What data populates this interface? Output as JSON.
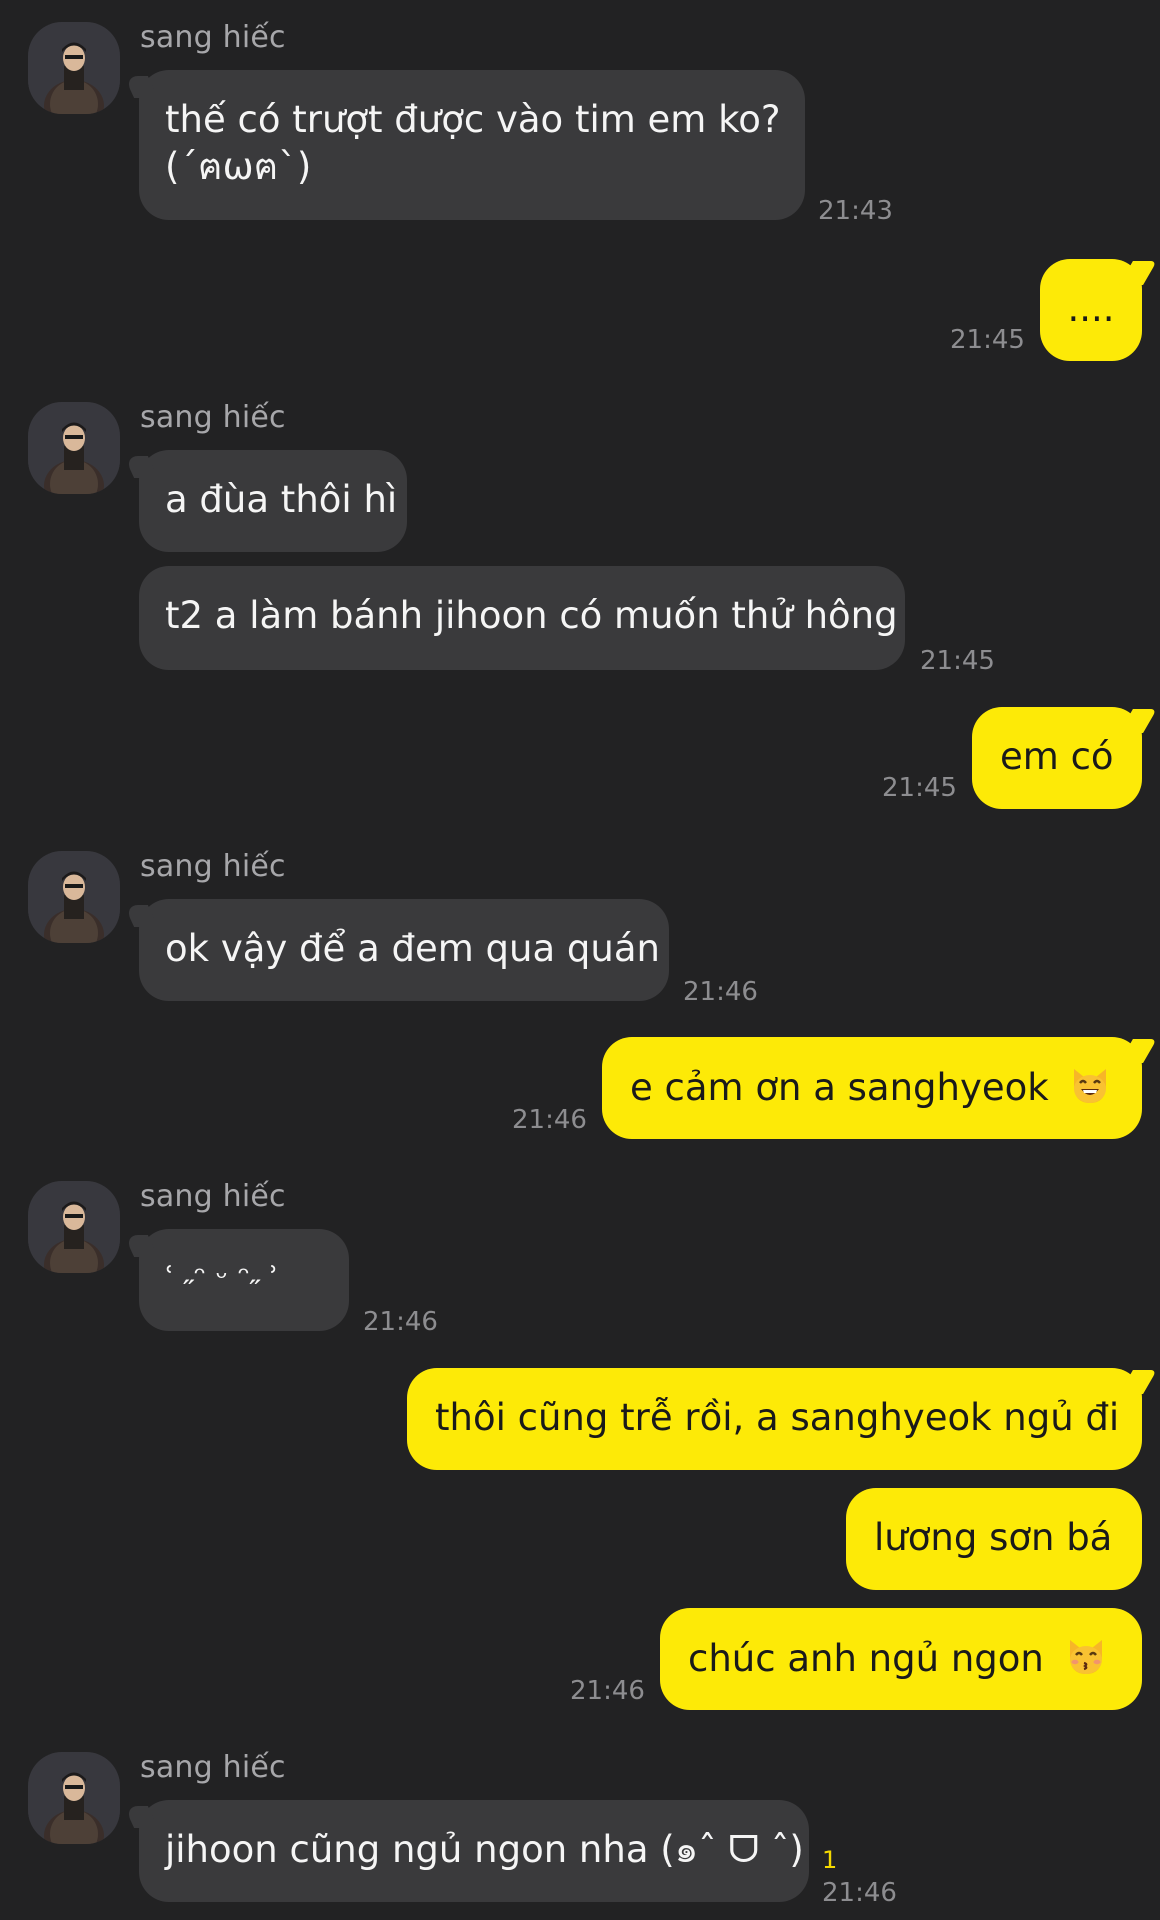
{
  "chat": {
    "messages": [
      {
        "id": "m1",
        "side": "in",
        "sender": "sang hiếc",
        "lines": [
          "thế có trượt được vào tim em ko?",
          "(´ฅωฅ`)"
        ],
        "time": "21:43"
      },
      {
        "id": "m2",
        "side": "out",
        "text": "....",
        "time": "21:45"
      },
      {
        "id": "m3",
        "side": "in",
        "sender": "sang hiếc",
        "text": "a đùa thôi hì"
      },
      {
        "id": "m4",
        "side": "in",
        "text": "t2 a làm bánh jihoon có muốn thử hông",
        "time": "21:45"
      },
      {
        "id": "m5",
        "side": "out",
        "text": "em có",
        "time": "21:45"
      },
      {
        "id": "m6",
        "side": "in",
        "sender": "sang hiếc",
        "text": "ok vậy để a đem qua quán",
        "time": "21:46"
      },
      {
        "id": "m7",
        "side": "out",
        "text": "e cảm ơn a sanghyeok",
        "emoji": "grinning-cat-emoji",
        "time": "21:46"
      },
      {
        "id": "m8",
        "side": "in",
        "sender": "sang hiếc",
        "text": "ʿ ˶ᵔ ᵕ ᵔ˶ ʾ",
        "time": "21:46"
      },
      {
        "id": "m9",
        "side": "out",
        "text": "thôi cũng trễ rồi, a sanghyeok ngủ đi"
      },
      {
        "id": "m10",
        "side": "out",
        "text": "lương sơn bá"
      },
      {
        "id": "m11",
        "side": "out",
        "text": "chúc anh ngủ ngon",
        "emoji": "kissing-cat-emoji",
        "time": "21:46"
      },
      {
        "id": "m12",
        "side": "in",
        "sender": "sang hiếc",
        "text": "jihoon cũng ngủ ngon nha (๑ˆ ᗜ ˆ)",
        "time": "21:46",
        "unread": "1"
      }
    ]
  },
  "colors": {
    "background": "#222223",
    "incoming_bubble": "#3a3a3c",
    "outgoing_bubble": "#fdea07",
    "unread_badge": "#f4d900"
  }
}
